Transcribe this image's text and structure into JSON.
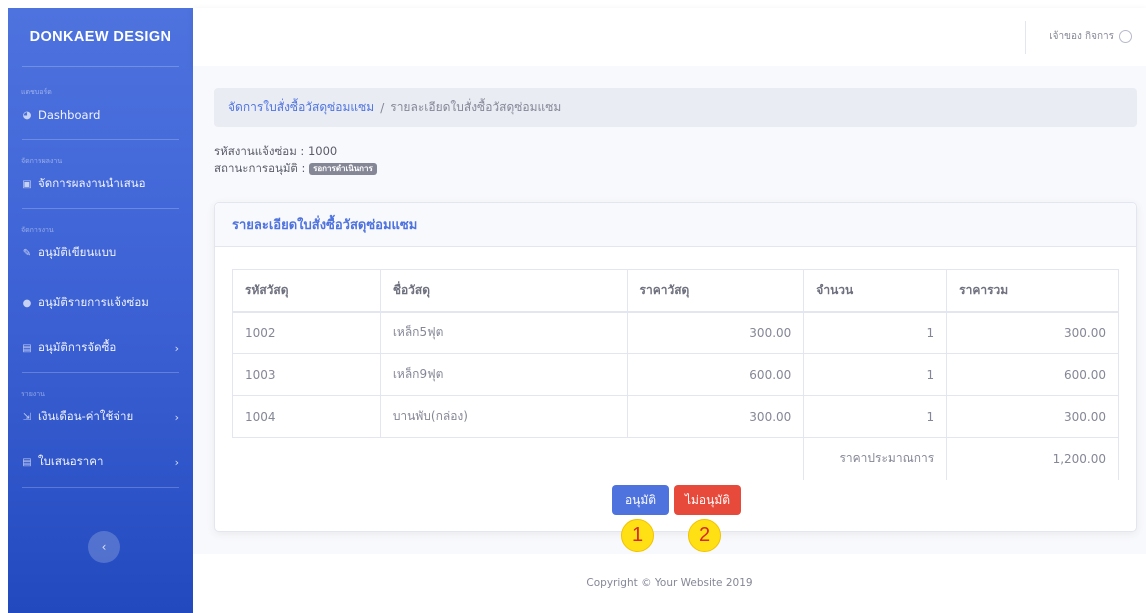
{
  "sidebar": {
    "brand": "DONKAEW DESIGN",
    "sections": {
      "dashboard_heading": "แดชบอร์ด",
      "manage_work_heading": "จัดการผลงาน",
      "jobs_heading": "จัดการงาน",
      "reports_heading": "รายงาน"
    },
    "items": [
      {
        "label": "Dashboard",
        "icon": "tachometer-icon"
      },
      {
        "label": "จัดการผลงานนำเสนอ",
        "icon": "image-icon"
      },
      {
        "label": "อนุมัติเขียนแบบ",
        "icon": "pencil-icon"
      },
      {
        "label": "อนุมัติรายการแจ้งซ่อม",
        "icon": "comment-icon"
      },
      {
        "label": "อนุมัติการจัดซื้อ",
        "icon": "file-icon",
        "chevron": true
      },
      {
        "label": "เงินเดือน-ค่าใช้จ่าย",
        "icon": "hand-holding-icon",
        "chevron": true
      },
      {
        "label": "ใบเสนอราคา",
        "icon": "file-icon",
        "chevron": true
      }
    ]
  },
  "topbar": {
    "user_name": "เจ้าของ กิจการ",
    "user_icon": "user-circle-icon"
  },
  "breadcrumb": {
    "parent": "จัดการใบสั่งซื้อวัสดุซ่อมแซม",
    "separator": "/",
    "current": "รายละเอียดใบสั่งซื้อวัสดุซ่อมแซม"
  },
  "info": {
    "job_code_label": "รหัสงานแจ้งซ่อม :",
    "job_code_value": "1000",
    "status_label": "สถานะการอนุมัติ :",
    "status_badge": "รอการดำเนินการ"
  },
  "card": {
    "title": "รายละเอียดใบสั่งซื้อวัสดุซ่อมแซม",
    "table": {
      "headers": [
        "รหัสวัสดุ",
        "ชื่อวัสดุ",
        "ราคาวัสดุ",
        "จำนวน",
        "ราคารวม"
      ],
      "rows": [
        [
          "1002",
          "เหล็ก5ฟุต",
          "300.00",
          "1",
          "300.00"
        ],
        [
          "1003",
          "เหล็ก9ฟุต",
          "600.00",
          "1",
          "600.00"
        ],
        [
          "1004",
          "บานพับ(กล่อง)",
          "300.00",
          "1",
          "300.00"
        ]
      ],
      "total_label": "ราคาประมาณการ",
      "total_value": "1,200.00"
    },
    "approve_button": "อนุมัติ",
    "reject_button": "ไม่อนุมัติ"
  },
  "markers": [
    "1",
    "2"
  ],
  "footer": "Copyright © Your Website 2019",
  "colors": {
    "primary": "#4e73df",
    "danger": "#e74a3b",
    "secondary": "#858796",
    "marker": "#ffe014"
  }
}
